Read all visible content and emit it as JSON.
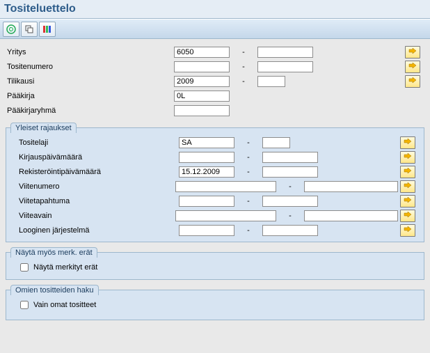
{
  "title": "Tositeluettelo",
  "icons": {
    "execute": "execute-icon",
    "variant": "variant-icon",
    "dynsel": "dynamic-selection-icon"
  },
  "top_rows": [
    {
      "label": "Yritys",
      "v1": "6050",
      "v2": "",
      "arrow": true,
      "size": "s",
      "v2size": "s"
    },
    {
      "label": "Tositenumero",
      "v1": "",
      "v2": "",
      "arrow": true,
      "size": "m",
      "v2size": "m"
    },
    {
      "label": "Tilikausi",
      "v1": "2009",
      "v2": "",
      "arrow": true,
      "size": "s",
      "v2size": "n"
    },
    {
      "label": "Pääkirja",
      "v1": "0L",
      "v2": null,
      "arrow": false,
      "size": "s"
    },
    {
      "label": "Pääkirjaryhmä",
      "v1": "",
      "v2": null,
      "arrow": false,
      "size": "s"
    }
  ],
  "group1": {
    "legend": "Yleiset rajaukset",
    "rows": [
      {
        "label": "Tositelaji",
        "v1": "SA",
        "v2": "",
        "arrow": true,
        "size": "s",
        "v2size": "n"
      },
      {
        "label": "Kirjauspäivämäärä",
        "v1": "",
        "v2": "",
        "arrow": true,
        "size": "m",
        "v2size": "m"
      },
      {
        "label": "Rekisteröintipäivämäärä",
        "v1": "15.12.2009",
        "v2": "",
        "arrow": true,
        "size": "m",
        "v2size": "m"
      },
      {
        "label": "Viitenumero",
        "v1": "",
        "v2": "",
        "arrow": true,
        "size": "w",
        "v2size": "w"
      },
      {
        "label": "Viitetapahtuma",
        "v1": "",
        "v2": "",
        "arrow": true,
        "size": "m",
        "v2size": "m"
      },
      {
        "label": "Viiteavain",
        "v1": "",
        "v2": "",
        "arrow": true,
        "size": "w",
        "v2size": "w"
      },
      {
        "label": "Looginen järjestelmä",
        "v1": "",
        "v2": "",
        "arrow": true,
        "size": "m",
        "v2size": "m"
      }
    ]
  },
  "group2": {
    "legend": "Näytä myös merk. erät",
    "chk_label": "Näytä merkityt erät",
    "checked": false
  },
  "group3": {
    "legend": "Omien tositteiden haku",
    "chk_label": "Vain omat tositteet",
    "checked": false
  },
  "dash": "-"
}
